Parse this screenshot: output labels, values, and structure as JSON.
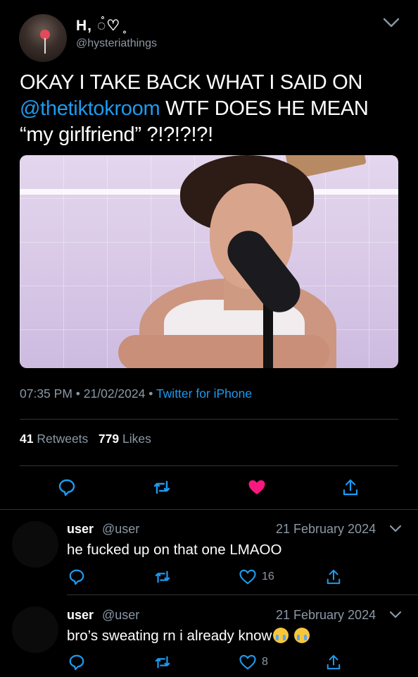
{
  "tweet": {
    "display_name": "H, ◌̊♡ ̥",
    "handle": "@hysteriathings",
    "text_line1": "OKAY I TAKE BACK WHAT I SAID ON",
    "mention": "@thetiktokroom",
    "text_line2_rest": " WTF DOES HE MEAN",
    "text_line3": "“my girlfriend” ?!?!?!?!",
    "time": "07:35 PM",
    "date": "21/02/2024",
    "client": "Twitter for iPhone",
    "retweets_count": "41",
    "retweets_label": "Retweets",
    "likes_count": "779",
    "likes_label": "Likes",
    "liked": true
  },
  "replies": [
    {
      "name": "user",
      "handle": "@user",
      "date": "21 February 2024",
      "text": "he fucked up on that one LMAOO",
      "likes": "16"
    },
    {
      "name": "user",
      "handle": "@user",
      "date": "21 February 2024",
      "text": "bro’s sweating rn i already know",
      "emoji": [
        "loudly-crying-face",
        "loudly-crying-face"
      ],
      "likes": "8"
    }
  ],
  "icons": {
    "reply": "reply-icon",
    "retweet": "retweet-icon",
    "like": "heart-icon",
    "share": "share-icon",
    "menu": "chevron-down-icon"
  },
  "colors": {
    "background": "#000000",
    "link": "#1d9bf0",
    "muted": "#8b98a5",
    "like": "#f91880"
  }
}
